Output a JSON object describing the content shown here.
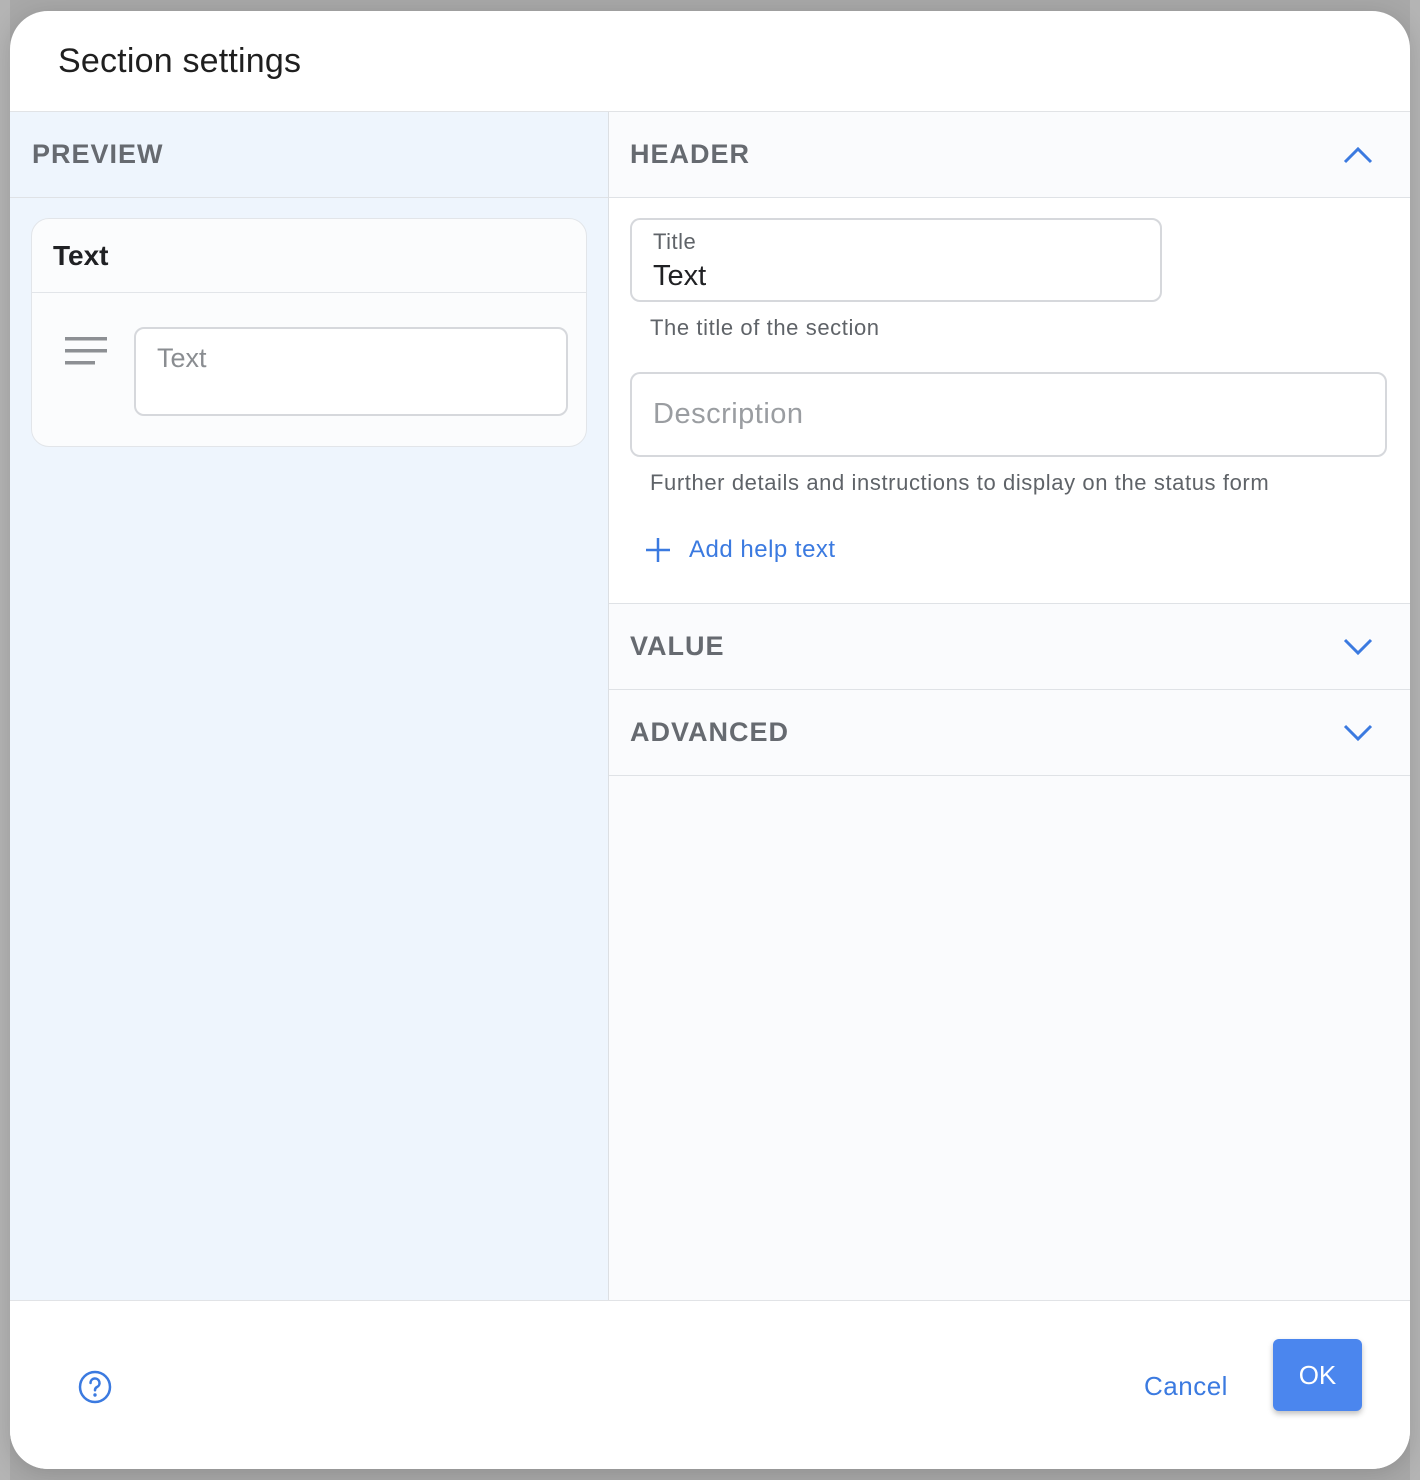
{
  "dialog": {
    "title": "Section settings"
  },
  "preview": {
    "heading": "PREVIEW",
    "card_title": "Text",
    "input_placeholder": "Text"
  },
  "header_section": {
    "heading": "HEADER",
    "title_field": {
      "label": "Title",
      "value": "Text",
      "helper": "The title of the section"
    },
    "description_field": {
      "placeholder": "Description",
      "helper": "Further details and instructions to display on the status form"
    },
    "add_help_label": "Add help text"
  },
  "value_section": {
    "heading": "VALUE"
  },
  "advanced_section": {
    "heading": "ADVANCED"
  },
  "footer": {
    "cancel_label": "Cancel",
    "ok_label": "OK"
  },
  "icons": {
    "expanded": "chevron-up-icon",
    "collapsed": "chevron-down-icon",
    "add": "plus-icon",
    "help": "help-circle-icon",
    "paragraph": "text-lines-icon"
  },
  "colors": {
    "accent": "#3b7ae0",
    "primary_button": "#4b86ee",
    "preview_bg": "#eef5fd"
  }
}
